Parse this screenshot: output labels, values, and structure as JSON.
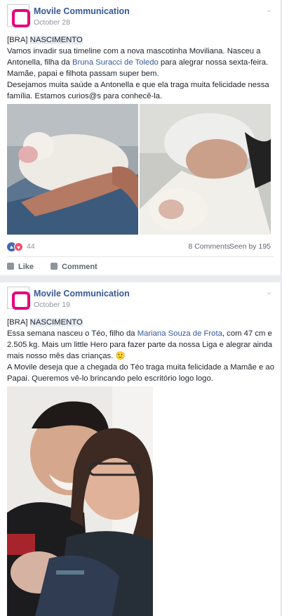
{
  "posts": [
    {
      "page_name": "Movile Communication",
      "date": "October 28",
      "tag": "[BRA] ",
      "tag_word": "NASCIMENTO",
      "p1": "Vamos invadir sua timeline com a nova mascotinha Moviliana. Nasceu a Antonella, filha da ",
      "mention": "Bruna Suracci de Toledo",
      "p1b": " para alegrar nossa sexta-feira. Mamãe, papai e filhota passam super bem.",
      "p2": "Desejamos muita saúde a Antonella e que ela traga muita felicidade nessa família. Estamos curios@s para conhecê-la.",
      "reactions_count": "44",
      "comments": "8 Comments",
      "seen": "Seen by 195",
      "like_label": "Like",
      "comment_label": "Comment"
    },
    {
      "page_name": "Movile Communication",
      "date": "October 19",
      "tag": "[BRA] ",
      "tag_word": "NASCIMENTO",
      "p1": "Essa semana nasceu o Téo, filho da ",
      "mention": "Mariana Souza de Frota",
      "p1b": ", com 47 cm e 2.505 kg. Mais um little Hero para fazer parte da nossa Liga e alegrar ainda mais nosso mês das crianças. 🙂",
      "p2": "A Movile deseja que a chegada do Téo traga muita felicidade a Mamãe e ao Papai. Queremos vê-lo brincando pelo escritório logo logo."
    }
  ],
  "icons": {
    "menu": "chevron-down-icon",
    "like": "thumbs-up-icon",
    "love": "heart-icon",
    "comment": "comment-icon"
  },
  "colors": {
    "brand": "#e6007e",
    "link": "#365899",
    "like": "#4267b2",
    "love": "#f25268"
  }
}
